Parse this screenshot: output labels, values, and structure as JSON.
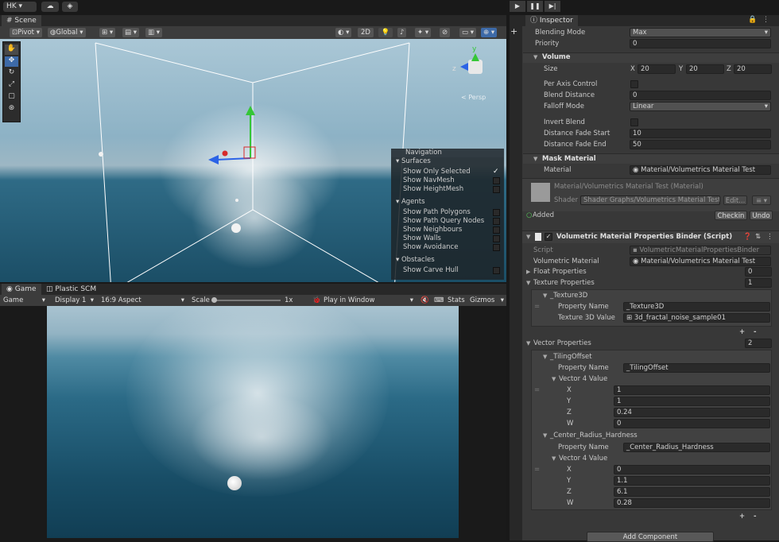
{
  "topbar": {
    "account": "HK",
    "play": "▶",
    "pause": "❚❚",
    "step": "▶|"
  },
  "scene": {
    "tab": "Scene",
    "pivot": "Pivot",
    "global": "Global",
    "btn_2d": "2D",
    "persp": "< Persp",
    "gizmo_axes": {
      "y": "y",
      "z": "z"
    },
    "navigation": {
      "title": "Navigation",
      "surfaces": "Surfaces",
      "surfaces_items": [
        "Show Only Selected",
        "Show NavMesh",
        "Show HeightMesh"
      ],
      "agents": "Agents",
      "agents_items": [
        "Show Path Polygons",
        "Show Path Query Nodes",
        "Show Neighbours",
        "Show Walls",
        "Show Avoidance"
      ],
      "obstacles": "Obstacles",
      "obstacles_items": [
        "Show Carve Hull"
      ]
    }
  },
  "game": {
    "tab": "Game",
    "tab2": "Plastic SCM",
    "mode": "Game",
    "display": "Display 1",
    "aspect": "16:9 Aspect",
    "scale_label": "Scale",
    "scale_value": "1x",
    "play_in": "Play in Window",
    "stats": "Stats",
    "gizmos": "Gizmos"
  },
  "inspector": {
    "tab": "Inspector",
    "blending_mode_label": "Blending Mode",
    "blending_mode_value": "Max",
    "priority_label": "Priority",
    "priority_value": "0",
    "volume_header": "Volume",
    "size_label": "Size",
    "size": {
      "x_label": "X",
      "x": "20",
      "y_label": "Y",
      "y": "20",
      "z_label": "Z",
      "z": "20"
    },
    "per_axis_label": "Per Axis Control",
    "blend_distance_label": "Blend Distance",
    "blend_distance_value": "0",
    "falloff_label": "Falloff Mode",
    "falloff_value": "Linear",
    "invert_blend_label": "Invert Blend",
    "fade_start_label": "Distance Fade Start",
    "fade_start_value": "10",
    "fade_end_label": "Distance Fade End",
    "fade_end_value": "50",
    "mask_header": "Mask Material",
    "material_label": "Material",
    "material_value": "Material/Volumetrics Material Test",
    "mat_preview_name": "Material/Volumetrics Material Test (Material)",
    "shader_label": "Shader",
    "shader_value": "Shader Graphs/Volumetrics Material Test",
    "edit_btn": "Edit...",
    "added_label": "Added",
    "checkin_btn": "Checkin",
    "undo_btn": "Undo",
    "component_title": "Volumetric Material Properties Binder (Script)",
    "script_label": "Script",
    "script_value": "VolumetricMaterialPropertiesBinder",
    "vol_mat_label": "Volumetric Material",
    "vol_mat_value": "Material/Volumetrics Material Test",
    "float_props_label": "Float Properties",
    "float_props_count": "0",
    "texture_props_label": "Texture Properties",
    "texture_props_count": "1",
    "texture_item": {
      "name": "_Texture3D",
      "prop_name_label": "Property Name",
      "prop_name_value": "_Texture3D",
      "value_label": "Texture 3D Value",
      "value": "3d_fractal_noise_sample01"
    },
    "vector_props_label": "Vector Properties",
    "vector_props_count": "2",
    "vector_items": [
      {
        "name": "_TilingOffset",
        "prop_name_label": "Property Name",
        "prop_name_value": "_TilingOffset",
        "vec_label": "Vector 4 Value",
        "x_label": "X",
        "x": "1",
        "y_label": "Y",
        "y": "1",
        "z_label": "Z",
        "z": "0.24",
        "w_label": "W",
        "w": "0"
      },
      {
        "name": "_Center_Radius_Hardness",
        "prop_name_label": "Property Name",
        "prop_name_value": "_Center_Radius_Hardness",
        "vec_label": "Vector 4 Value",
        "x_label": "X",
        "x": "0",
        "y_label": "Y",
        "y": "1.1",
        "z_label": "Z",
        "z": "6.1",
        "w_label": "W",
        "w": "0.28"
      }
    ],
    "plus": "+",
    "minus": "-",
    "add_component": "Add Component"
  },
  "colors": {
    "accent_blue": "#3d6aa8",
    "dark_bg": "#191919",
    "panel_bg": "#383838"
  }
}
